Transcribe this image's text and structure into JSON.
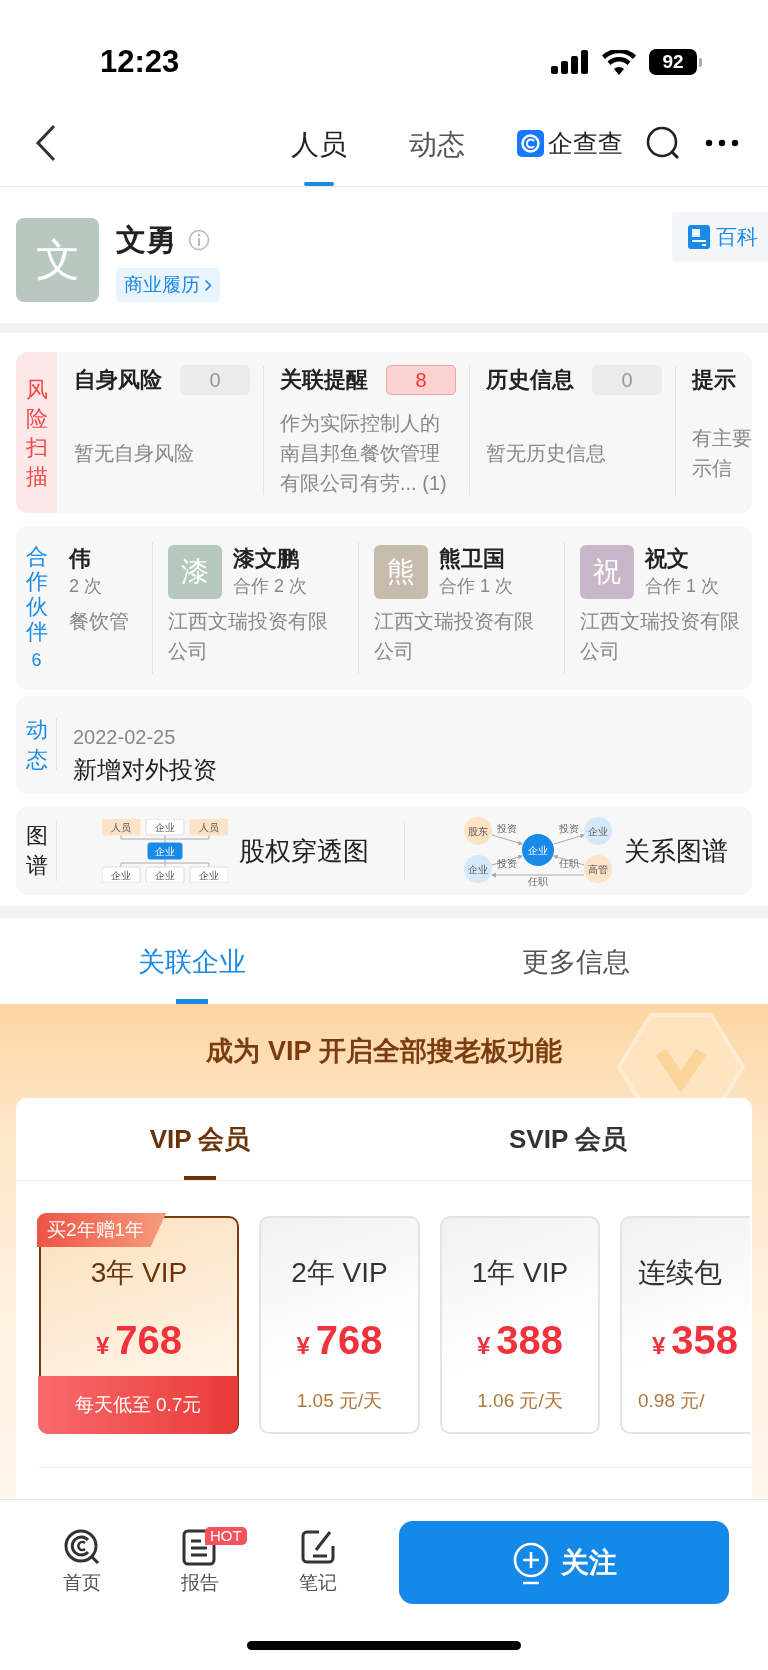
{
  "status_bar": {
    "time": "12:23",
    "battery": "92"
  },
  "nav": {
    "tabs": [
      {
        "label": "人员",
        "selected": true
      },
      {
        "label": "动态",
        "selected": false
      }
    ],
    "brand": "企查查"
  },
  "profile": {
    "avatar": "文",
    "name": "文勇",
    "tag": "商业履历",
    "wiki_button": "百科"
  },
  "risk_scan": {
    "label": "风险扫描",
    "items": [
      {
        "title": "自身风险",
        "count": "0",
        "alert": false,
        "text": "暂无自身风险"
      },
      {
        "title": "关联提醒",
        "count": "8",
        "alert": true,
        "text": "作为实际控制人的南昌邦鱼餐饮管理有限公司有劳... (1)"
      },
      {
        "title": "历史信息",
        "count": "0",
        "alert": false,
        "text": "暂无历史信息"
      },
      {
        "title": "提示",
        "text": "有主要示信"
      }
    ]
  },
  "partners": {
    "label": "合作伙伴",
    "count": "6",
    "items": [
      {
        "name": "伟",
        "times": "2 次",
        "company": "餐饮管"
      },
      {
        "avatar": "漆",
        "color": "#b6c7bd",
        "name": "漆文鹏",
        "times": "合作 2 次",
        "company": "江西文瑞投资有限公司"
      },
      {
        "avatar": "熊",
        "color": "#c6bcae",
        "name": "熊卫国",
        "times": "合作 1 次",
        "company": "江西文瑞投资有限公司"
      },
      {
        "avatar": "祝",
        "color": "#c9b7c9",
        "name": "祝文",
        "times": "合作 1 次",
        "company": "江西文瑞投资有限公司"
      }
    ]
  },
  "dynamics": {
    "label": "动态",
    "date": "2022-02-25",
    "text": "新增对外投资"
  },
  "graphs": {
    "label": "图谱",
    "items": [
      {
        "kind": "equity",
        "title": "股权穿透图",
        "nodes": [
          "人员",
          "企业",
          "人员",
          "企业",
          "企业",
          "企业",
          "企业"
        ]
      },
      {
        "kind": "relation",
        "title": "关系图谱",
        "nodes": [
          "股东",
          "企业",
          "企业",
          "企业",
          "高管"
        ],
        "edges": [
          "投资",
          "投资",
          "投资",
          "任职",
          "任职"
        ]
      }
    ]
  },
  "section_tabs": [
    {
      "label": "关联企业",
      "selected": true
    },
    {
      "label": "更多信息",
      "selected": false
    }
  ],
  "vip": {
    "headline": "成为 VIP 开启全部搜老板功能",
    "tabs": [
      {
        "label": "VIP 会员",
        "selected": true
      },
      {
        "label": "SVIP 会员",
        "selected": false
      }
    ],
    "plans": [
      {
        "promo": "买2年赠1年",
        "title": "3年 VIP",
        "currency": "¥",
        "price": "768",
        "per_day": "每天低至 0.7元",
        "selected": true
      },
      {
        "title": "2年 VIP",
        "currency": "¥",
        "price": "768",
        "per_day": "1.05 元/天",
        "selected": false
      },
      {
        "title": "1年 VIP",
        "currency": "¥",
        "price": "388",
        "per_day": "1.06 元/天",
        "selected": false
      },
      {
        "title": "连续包",
        "currency": "¥",
        "price": "358",
        "per_day": "0.98 元/",
        "selected": false
      }
    ]
  },
  "bottom_bar": {
    "items": [
      {
        "kind": "home",
        "label": "首页"
      },
      {
        "kind": "report",
        "label": "报告",
        "badge": "HOT"
      },
      {
        "kind": "note",
        "label": "笔记"
      }
    ],
    "follow_button": "关注"
  }
}
